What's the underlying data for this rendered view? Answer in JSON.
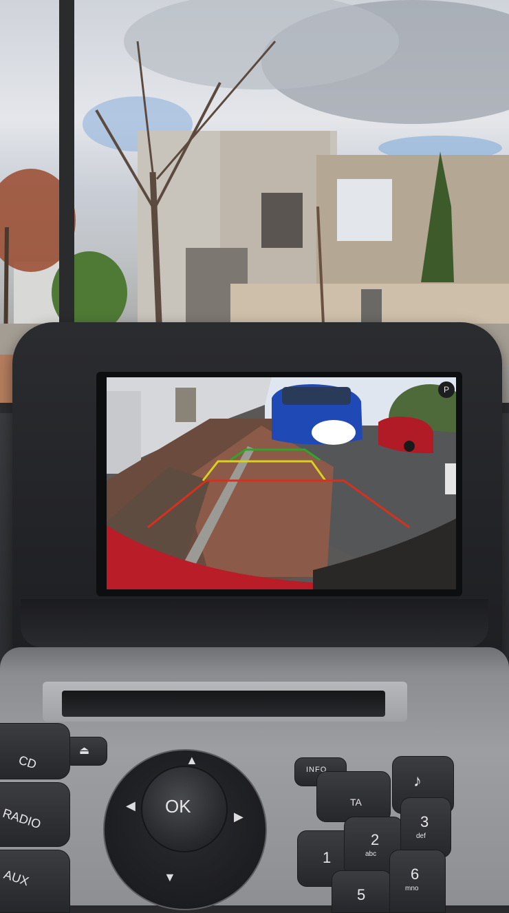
{
  "screen": {
    "corner_badge": "P"
  },
  "controls": {
    "eject_icon": "eject-icon",
    "info_label": "INFO",
    "ok_label": "OK",
    "cd_label": "CD",
    "radio_label": "RADIO",
    "aux_label": "AUX",
    "ta_label": "TA",
    "music_icon": "music-note-icon",
    "keypad": [
      {
        "digit": "1",
        "sub": ""
      },
      {
        "digit": "2",
        "sub": "abc"
      },
      {
        "digit": "3",
        "sub": "def"
      },
      {
        "digit": "5",
        "sub": ""
      },
      {
        "digit": "6",
        "sub": "mno"
      }
    ]
  },
  "colors": {
    "guide_green": "#2fa52a",
    "guide_yellow": "#d9d21f",
    "guide_red": "#d8301e"
  }
}
